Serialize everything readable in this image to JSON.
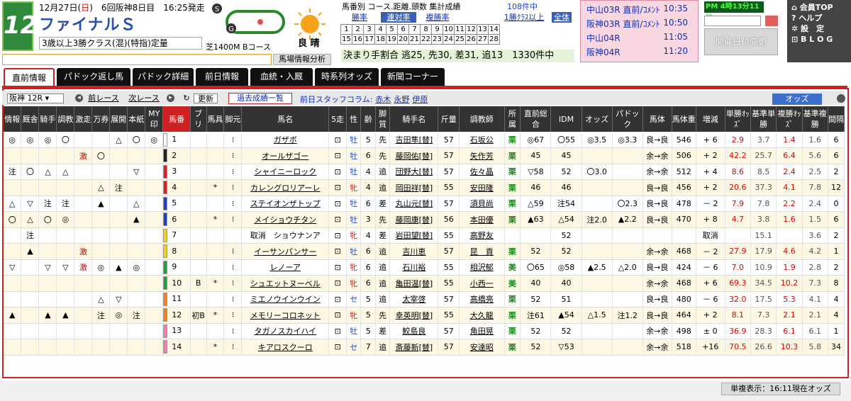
{
  "race": {
    "number": "12",
    "date_pre": "12月27日(",
    "weekday": "日",
    "date_post": ")　6回阪神8日目　16:25発走",
    "name": "ファイナルＳ",
    "condition": "3歳以上3勝クラス(混)(特指)定量",
    "course": "芝1400M  Bコース",
    "weather": "良 晴"
  },
  "header": {
    "kaiseki": "馬場情報分析",
    "stats_title": "馬番別 コース.距離.頭数 集計成績",
    "stats_count": "108件中",
    "stats_buttons": [
      "勝率",
      "連対率",
      "複勝率"
    ],
    "stats_class": "1勝ｸﾗｽ以上",
    "stats_all": "全体",
    "grid_numbers": [
      [
        "1",
        "2",
        "3",
        "4",
        "5",
        "6",
        "7",
        "8",
        "9",
        "10",
        "11",
        "12",
        "13",
        "14"
      ],
      [
        "15",
        "16",
        "17",
        "18",
        "19",
        "20",
        "21",
        "22",
        "23",
        "24",
        "25",
        "26",
        "27",
        "28"
      ]
    ],
    "kimari": "決まり手割合 逃25, 先30, 差31, 追13　1330件中"
  },
  "race_links": [
    {
      "label": "中山03R  直前/ｺﾒﾝﾄ",
      "time": "10:35"
    },
    {
      "label": "阪神03R  直前/ｺﾒﾝﾄ",
      "time": "10:50"
    },
    {
      "label": "中山04R",
      "time": "11:05"
    },
    {
      "label": "阪神04R",
      "time": "11:20"
    }
  ],
  "clock": "PM  4時13分11秒",
  "henko": "開催日付変更",
  "menu": [
    "⌂ 会員TOP",
    "? ヘルプ",
    "✲ 設　定",
    "⊡ B L O G"
  ],
  "tabs": [
    "直前情報",
    "パドック返し馬",
    "パドック詳細",
    "前日情報",
    "血統・入厩",
    "時系列オッズ",
    "新聞コーナー"
  ],
  "toolbar": {
    "race_select": "阪神 12R",
    "prev": "前レース",
    "next": "次レース",
    "update": "更新",
    "kako": "過去成績一覧",
    "staff_label": "前日スタッフコラム:",
    "staff": [
      "赤木",
      "永野",
      "伊原"
    ],
    "odds": "オッズ"
  },
  "columns": [
    "情報",
    "厩舎",
    "騎手",
    "調教",
    "激走",
    "万券",
    "展開",
    "本紙",
    "MY印",
    "馬番",
    "ブリ",
    "馬具",
    "脚元",
    "馬名",
    "5走",
    "性",
    "齢",
    "脚質",
    "騎手名",
    "斤量",
    "調教師",
    "所属",
    "直前総合",
    "IDM",
    "オッズ",
    "パドック",
    "馬体",
    "馬体重",
    "増減",
    "単勝ｵｯｽﾞ",
    "基準単勝",
    "複勝ｵｯｽﾞ",
    "基準複勝",
    "間隔"
  ],
  "gate_colors": [
    "#ffffff",
    "#222222",
    "#e02020",
    "#e02020",
    "#2040c0",
    "#2040c0",
    "#f0d020",
    "#f0d020",
    "#20a040",
    "#20a040",
    "#f08020",
    "#f08020",
    "#f080b0",
    "#f080b0"
  ],
  "horses": [
    {
      "info": "◎",
      "kyu": "◎",
      "ki": "◎",
      "cho": "〇",
      "geki": "",
      "man": "",
      "ten": "△",
      "hon": "〇",
      "my": "◎",
      "no": "1",
      "buri": "",
      "bagu": "",
      "ashi": "⁝",
      "name": "ガザボ",
      "go": "⊡",
      "sex": "牡",
      "age": "5",
      "kyaku": "先",
      "jockey": "吉田隼[替]",
      "kin": "57",
      "trainer": "石坂公",
      "sho": "栗",
      "choku": "◎67",
      "idm": "〇55",
      "odds_p": "◎3.5",
      "pad": "◎3.3",
      "taikei": "良→良",
      "weight": "546",
      "zogen": "+ 6",
      "tan": "2.9",
      "kt": "3.7",
      "fuku": "1.4",
      "kf": "1.6",
      "kan": "6"
    },
    {
      "info": "",
      "kyu": "",
      "ki": "",
      "cho": "",
      "geki": "激",
      "man": "〇",
      "ten": "",
      "hon": "",
      "my": "",
      "no": "2",
      "buri": "",
      "bagu": "",
      "ashi": "⁝",
      "name": "オールザゴー",
      "go": "⊡",
      "sex": "牡",
      "age": "6",
      "kyaku": "先",
      "jockey": "藤岡佑[替]",
      "kin": "57",
      "trainer": "矢作芳",
      "sho": "栗",
      "choku": "45",
      "idm": "45",
      "odds_p": "",
      "pad": "",
      "taikei": "余→余",
      "weight": "506",
      "zogen": "+ 2",
      "tan": "42.2",
      "kt": "25.7",
      "fuku": "6.4",
      "kf": "5.6",
      "kan": "6"
    },
    {
      "info": "注",
      "kyu": "〇",
      "ki": "△",
      "cho": "△",
      "geki": "",
      "man": "",
      "ten": "",
      "hon": "▽",
      "my": "",
      "no": "3",
      "buri": "",
      "bagu": "",
      "ashi": "⁝",
      "name": "シャイニーロック",
      "go": "⊡",
      "sex": "牡",
      "age": "4",
      "kyaku": "追",
      "jockey": "団野大[替]",
      "kin": "57",
      "trainer": "佐々晶",
      "sho": "栗",
      "choku": "▽58",
      "idm": "52",
      "odds_p": "〇3.0",
      "pad": "",
      "taikei": "余→余",
      "weight": "512",
      "zogen": "+ 4",
      "tan": "8.6",
      "kt": "8.5",
      "fuku": "2.4",
      "kf": "2.5",
      "kan": "2"
    },
    {
      "info": "",
      "kyu": "",
      "ki": "",
      "cho": "",
      "geki": "",
      "man": "△",
      "ten": "注",
      "hon": "",
      "my": "",
      "no": "4",
      "buri": "",
      "bagu": "*",
      "ashi": "⁝",
      "name": "カレングロリアーレ",
      "go": "⊡",
      "sex": "牝",
      "age": "4",
      "kyaku": "追",
      "jockey": "岡田祥[替]",
      "kin": "55",
      "trainer": "安田隆",
      "sho": "栗",
      "choku": "46",
      "idm": "46",
      "odds_p": "",
      "pad": "",
      "taikei": "良→良",
      "weight": "456",
      "zogen": "+ 2",
      "tan": "20.6",
      "kt": "37.3",
      "fuku": "4.1",
      "kf": "7.8",
      "kan": "12"
    },
    {
      "info": "△",
      "kyu": "▽",
      "ki": "注",
      "cho": "注",
      "geki": "",
      "man": "▲",
      "ten": "",
      "hon": "△",
      "my": "",
      "no": "5",
      "buri": "",
      "bagu": "",
      "ashi": "⁝",
      "name": "ステイオンザトップ",
      "go": "⊡",
      "sex": "牡",
      "age": "6",
      "kyaku": "差",
      "jockey": "丸山元[替]",
      "kin": "57",
      "trainer": "須貝尚",
      "sho": "栗",
      "choku": "△59",
      "idm": "注54",
      "odds_p": "",
      "pad": "〇2.3",
      "taikei": "良→良",
      "weight": "478",
      "zogen": "－ 2",
      "tan": "7.9",
      "kt": "7.8",
      "fuku": "2.2",
      "kf": "2.4",
      "kan": "0"
    },
    {
      "info": "〇",
      "kyu": "△",
      "ki": "〇",
      "cho": "◎",
      "geki": "",
      "man": "",
      "ten": "",
      "hon": "▲",
      "my": "",
      "no": "6",
      "buri": "",
      "bagu": "*",
      "ashi": "⁝",
      "name": "メイショウチタン",
      "go": "⊡",
      "sex": "牡",
      "age": "3",
      "kyaku": "先",
      "jockey": "藤岡康[替]",
      "kin": "56",
      "trainer": "本田優",
      "sho": "栗",
      "choku": "▲63",
      "idm": "△54",
      "odds_p": "注2.0",
      "pad": "▲2.2",
      "taikei": "良→良",
      "weight": "470",
      "zogen": "+ 8",
      "tan": "4.7",
      "kt": "3.8",
      "fuku": "1.6",
      "kf": "1.5",
      "kan": "6"
    },
    {
      "info": "",
      "kyu": "注",
      "ki": "",
      "cho": "",
      "geki": "",
      "man": "",
      "ten": "",
      "hon": "",
      "my": "",
      "no": "7",
      "buri": "",
      "bagu": "",
      "ashi": "",
      "name": "取消　ショウナンア",
      "go": "⊡",
      "sex": "牝",
      "age": "4",
      "kyaku": "差",
      "jockey": "岩田望[替]",
      "kin": "55",
      "trainer": "高野友",
      "sho": "",
      "choku": "",
      "idm": "52",
      "odds_p": "",
      "pad": "",
      "taikei": "",
      "weight": "",
      "zogen": "取消",
      "tan": "",
      "kt": "15.1",
      "fuku": "",
      "kf": "3.6",
      "kan": "2",
      "scratched": true
    },
    {
      "info": "",
      "kyu": "▲",
      "ki": "",
      "cho": "",
      "geki": "激",
      "man": "",
      "ten": "",
      "hon": "",
      "my": "",
      "no": "8",
      "buri": "",
      "bagu": "",
      "ashi": "⁝",
      "name": "イーサンパンサー",
      "go": "⊡",
      "sex": "牡",
      "age": "6",
      "kyaku": "追",
      "jockey": "吉川恵",
      "kin": "57",
      "trainer": "昆　貢",
      "sho": "栗",
      "choku": "52",
      "idm": "52",
      "odds_p": "",
      "pad": "",
      "taikei": "余→余",
      "weight": "468",
      "zogen": "－ 2",
      "tan": "27.9",
      "kt": "17.9",
      "fuku": "4.6",
      "kf": "4.2",
      "kan": "1"
    },
    {
      "info": "▽",
      "kyu": "",
      "ki": "▽",
      "cho": "▽",
      "geki": "激",
      "man": "◎",
      "ten": "▲",
      "hon": "◎",
      "my": "",
      "no": "9",
      "buri": "",
      "bagu": "",
      "ashi": "⁝",
      "name": "レノーア",
      "go": "⊡",
      "sex": "牝",
      "age": "6",
      "kyaku": "追",
      "jockey": "石川裕",
      "kin": "55",
      "trainer": "相沢郁",
      "sho": "美",
      "choku": "〇65",
      "idm": "◎58",
      "odds_p": "▲2.5",
      "pad": "△2.0",
      "taikei": "良→良",
      "weight": "424",
      "zogen": "－ 6",
      "tan": "7.0",
      "kt": "10.9",
      "fuku": "1.9",
      "kf": "2.8",
      "kan": "2"
    },
    {
      "info": "",
      "kyu": "",
      "ki": "",
      "cho": "",
      "geki": "",
      "man": "",
      "ten": "",
      "hon": "",
      "my": "",
      "no": "10",
      "buri": "B",
      "bagu": "*",
      "ashi": "⁝",
      "name": "シュエットヌーベル",
      "go": "⊡",
      "sex": "牝",
      "age": "6",
      "kyaku": "追",
      "jockey": "亀田温[替]",
      "kin": "55",
      "trainer": "小西一",
      "sho": "美",
      "choku": "40",
      "idm": "40",
      "odds_p": "",
      "pad": "",
      "taikei": "余→余",
      "weight": "468",
      "zogen": "+ 6",
      "tan": "69.3",
      "kt": "34.5",
      "fuku": "10.2",
      "kf": "7.3",
      "kan": "8"
    },
    {
      "info": "",
      "kyu": "",
      "ki": "",
      "cho": "",
      "geki": "",
      "man": "△",
      "ten": "▽",
      "hon": "",
      "my": "",
      "no": "11",
      "buri": "",
      "bagu": "",
      "ashi": "⁝",
      "name": "ミエノウインウイン",
      "go": "⊡",
      "sex": "セ",
      "age": "5",
      "kyaku": "追",
      "jockey": "太宰啓",
      "kin": "57",
      "trainer": "高橋亮",
      "sho": "栗",
      "choku": "52",
      "idm": "51",
      "odds_p": "",
      "pad": "",
      "taikei": "良→良",
      "weight": "480",
      "zogen": "－ 6",
      "tan": "32.0",
      "kt": "17.5",
      "fuku": "5.3",
      "kf": "4.1",
      "kan": "4"
    },
    {
      "info": "▲",
      "kyu": "",
      "ki": "▲",
      "cho": "▲",
      "geki": "",
      "man": "注",
      "ten": "◎",
      "hon": "注",
      "my": "",
      "no": "12",
      "buri": "初B",
      "bagu": "*",
      "ashi": "⁝",
      "name": "メモリーコロネット",
      "go": "⊡",
      "sex": "牝",
      "age": "5",
      "kyaku": "先",
      "jockey": "幸英明[替]",
      "kin": "55",
      "trainer": "大久龍",
      "sho": "栗",
      "choku": "注61",
      "idm": "▲54",
      "odds_p": "△1.5",
      "pad": "注1.2",
      "taikei": "良→良",
      "weight": "464",
      "zogen": "+ 2",
      "tan": "8.1",
      "kt": "7.3",
      "fuku": "2.1",
      "kf": "2.1",
      "kan": "4"
    },
    {
      "info": "",
      "kyu": "",
      "ki": "",
      "cho": "",
      "geki": "",
      "man": "",
      "ten": "",
      "hon": "",
      "my": "",
      "no": "13",
      "buri": "",
      "bagu": "",
      "ashi": "⁝",
      "name": "タガノスカイハイ",
      "go": "⊡",
      "sex": "牡",
      "age": "5",
      "kyaku": "差",
      "jockey": "鮫島良",
      "kin": "57",
      "trainer": "角田晃",
      "sho": "栗",
      "choku": "52",
      "idm": "52",
      "odds_p": "",
      "pad": "",
      "taikei": "余→余",
      "weight": "498",
      "zogen": "± 0",
      "tan": "36.9",
      "kt": "28.3",
      "fuku": "6.1",
      "kf": "6.1",
      "kan": "1"
    },
    {
      "info": "",
      "kyu": "",
      "ki": "",
      "cho": "",
      "geki": "",
      "man": "",
      "ten": "",
      "hon": "",
      "my": "",
      "no": "14",
      "buri": "",
      "bagu": "*",
      "ashi": "⁝",
      "name": "キアロスクーロ",
      "go": "⊡",
      "sex": "セ",
      "age": "7",
      "kyaku": "追",
      "jockey": "斎藤新[替]",
      "kin": "57",
      "trainer": "安達昭",
      "sho": "栗",
      "choku": "52",
      "idm": "▽53",
      "odds_p": "",
      "pad": "",
      "taikei": "余→余",
      "weight": "518",
      "zogen": "+16",
      "tan": "70.5",
      "kt": "26.6",
      "fuku": "10.3",
      "kf": "5.8",
      "kan": "34"
    }
  ],
  "footer": "単複表示：16:11現在オッズ"
}
